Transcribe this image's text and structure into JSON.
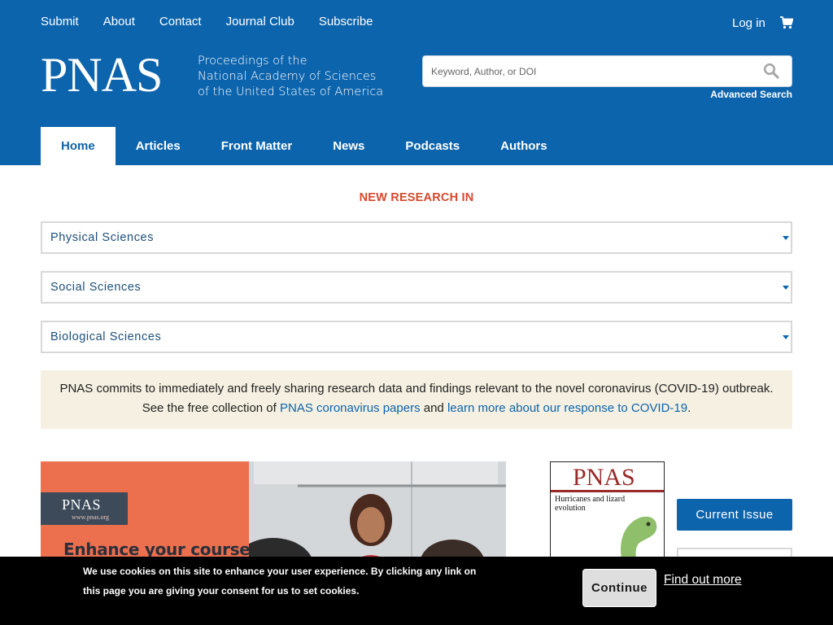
{
  "colors": {
    "brand_blue": "#0c64ad",
    "accent_red": "#d8492e",
    "notice_bg": "#f5f0e1",
    "cookie_bg": "#000000"
  },
  "topnav": {
    "items": [
      "Submit",
      "About",
      "Contact",
      "Journal Club",
      "Subscribe"
    ],
    "login": "Log in",
    "cart_icon": "cart-icon"
  },
  "logo": {
    "wordmark": "PNAS",
    "tagline": [
      "Proceedings of the",
      "National Academy of Sciences",
      "of the United States of America"
    ]
  },
  "search": {
    "placeholder": "Keyword, Author, or DOI",
    "icon": "search-icon",
    "advanced": "Advanced Search"
  },
  "mainnav": {
    "items": [
      "Home",
      "Articles",
      "Front Matter",
      "News",
      "Podcasts",
      "Authors"
    ],
    "active": "Home"
  },
  "new_research": {
    "heading": "NEW RESEARCH IN",
    "subjects": [
      "Physical Sciences",
      "Social Sciences",
      "Biological Sciences"
    ]
  },
  "notice": {
    "line1": "PNAS commits to immediately and freely sharing research data and findings relevant to the novel coronavirus (COVID-19) outbreak.",
    "line2_prefix": "See the free collection of ",
    "link1": "PNAS coronavirus papers",
    "middle": " and ",
    "link2": "learn more about our response to COVID-19",
    "suffix": "."
  },
  "banner": {
    "chip_word": "PNAS",
    "chip_url": "www.pnas.org",
    "headline": "Enhance your course"
  },
  "cover": {
    "wordmark": "PNAS",
    "title": "Hurricanes and lizard evolution"
  },
  "sidebar": {
    "current_issue": "Current Issue"
  },
  "cookie": {
    "message": "We use cookies on this site to enhance your user experience. By clicking any link on this page you are giving your consent for us to set cookies.",
    "continue": "Continue",
    "find_out": "Find out more"
  }
}
